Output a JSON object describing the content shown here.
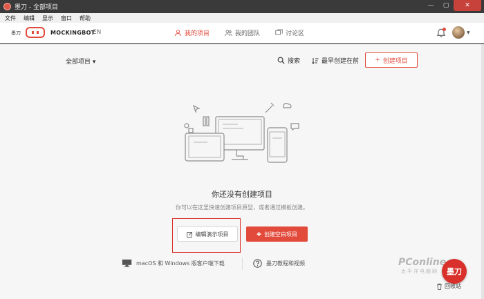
{
  "window": {
    "title": "墨刀 - 全部项目",
    "buttons": {
      "minimize": "—",
      "maximize": "▢",
      "close": "✕"
    }
  },
  "menubar": [
    "文件",
    "编辑",
    "显示",
    "窗口",
    "帮助"
  ],
  "header": {
    "brand_cn": "墨刀",
    "brand_name": "MOCKINGBOT",
    "lang": "EN",
    "nav": [
      {
        "label": "我的项目",
        "icon": "user-icon",
        "active": true
      },
      {
        "label": "我的团队",
        "icon": "team-icon",
        "active": false
      },
      {
        "label": "讨论区",
        "icon": "chat-icon",
        "active": false
      }
    ],
    "accent_color": "#e24a3b"
  },
  "toolbar": {
    "filter_label": "全部项目 ▾",
    "search_label": "搜索",
    "sort_label": "最早创建在前",
    "create_label": "创建项目"
  },
  "empty_state": {
    "title": "你还没有创建项目",
    "subtitle": "你可以在这里快速创建项目原型，或者通过模板创建。",
    "demo_button": "编辑演示项目",
    "blank_button": "创建空白项目"
  },
  "bottom": {
    "download_label": "macOS 和 Windows 版客户端下载",
    "help_label": "墨刀教程和视频"
  },
  "overlay": {
    "watermark": "PConline",
    "watermark_sub": "太平洋电脑网",
    "fab_label": "墨刀",
    "recycle_label": "回收站"
  }
}
